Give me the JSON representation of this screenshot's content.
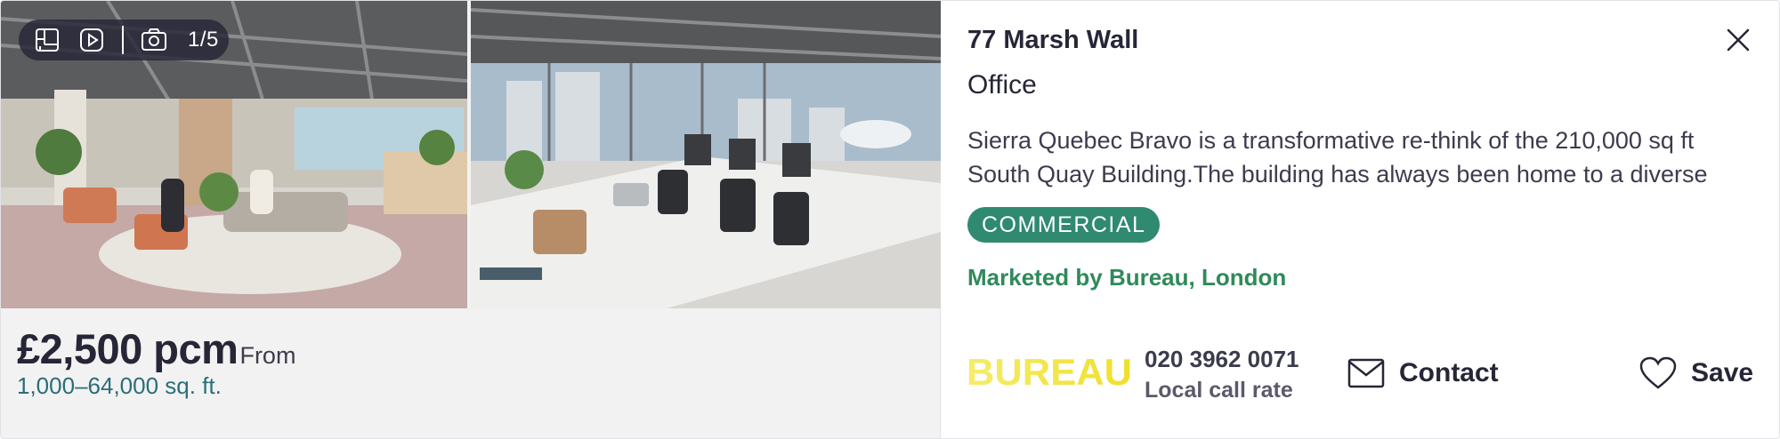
{
  "gallery": {
    "counter": "1/5",
    "icons": [
      "floorplan-icon",
      "video-icon",
      "camera-icon"
    ]
  },
  "listing": {
    "price": "£2,500 pcm",
    "price_qualifier": "From",
    "size": "1,000–64,000 sq. ft.",
    "address": "77 Marsh Wall",
    "property_type": "Office",
    "description": "Sierra Quebec Bravo is a transformative re-think of the 210,000 sq ft South Quay Building.The building has always been home to a diverse",
    "badge": "COMMERCIAL",
    "marketed_by": "Marketed by Bureau, London"
  },
  "agent": {
    "logo_text": "BUREAU",
    "phone": "020 3962 0071",
    "call_rate": "Local call rate"
  },
  "actions": {
    "contact_label": "Contact",
    "save_label": "Save"
  },
  "colors": {
    "badge_bg": "#2f8a6f",
    "marketed_text": "#2f8a5a",
    "size_text": "#2a6e79",
    "logo_yellow": "#f2e33a"
  }
}
